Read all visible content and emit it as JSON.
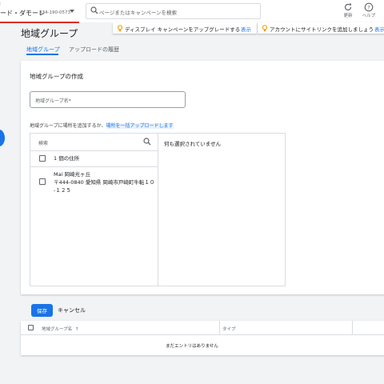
{
  "header": {
    "account_name": "ード・ダモーレ",
    "account_id": "334-190-0573",
    "search_placeholder": "ページまたはキャンペーンを検索",
    "refresh_label": "更新",
    "help_label": "ヘルプ"
  },
  "notifications": [
    {
      "text": "ディスプレイ キャンペーンをアップグレードする",
      "link": "表示"
    },
    {
      "text": "アカウントにサイトリンクを追加しましょう",
      "link": "表示"
    }
  ],
  "page_title": "地域グループ",
  "tabs": [
    {
      "label": "地域グループ",
      "active": true
    },
    {
      "label": "アップロードの履歴",
      "active": false
    }
  ],
  "form": {
    "title": "地域グループの作成",
    "name_placeholder": "地域グループ名*",
    "hint_prefix": "地域グループに場所を追加するか、",
    "hint_link": "場所を一括アップロードします",
    "search_placeholder": "検索",
    "select_all_label": "1 個の住所",
    "location": {
      "name": "Mai 岡崎光ヶ丘",
      "address_line1": "〒444-0840 愛知県 岡崎市戸崎町牛転１０",
      "address_line2": "-１２５"
    },
    "nothing_selected": "何も選択されていません"
  },
  "actions": {
    "save_label": "保存",
    "cancel_label": "キャンセル"
  },
  "table": {
    "columns": [
      {
        "label": "地域グループ名",
        "sort": "↑"
      },
      {
        "label": "タイプ"
      }
    ],
    "empty_text": "まだエントリはありません"
  },
  "colors": {
    "accent": "#1a73e8",
    "brand_underline": "#d93025",
    "notification_icon": "#f29900"
  }
}
